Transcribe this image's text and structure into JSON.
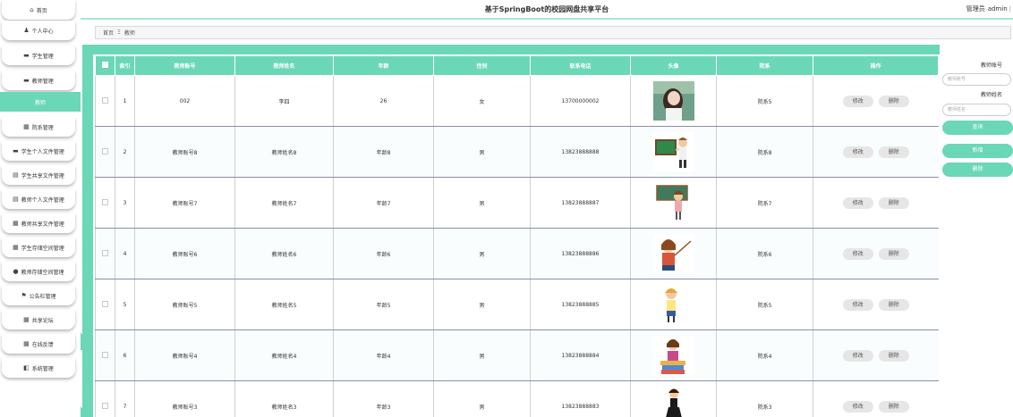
{
  "header": {
    "title": "基于SpringBoot的校园网盘共享平台",
    "role": "管理员",
    "username": "admin"
  },
  "sidebar": {
    "items": [
      {
        "icon": "home-icon",
        "glyph": "⌂",
        "label": "首页"
      },
      {
        "icon": "user-icon",
        "glyph": "♟",
        "label": "个人中心"
      },
      {
        "icon": "monitor-icon",
        "glyph": "▬",
        "label": "学生管理"
      },
      {
        "icon": "monitor-icon",
        "glyph": "▬",
        "label": "教师管理"
      },
      {
        "icon": "",
        "glyph": "",
        "label": "教师"
      },
      {
        "icon": "grid-icon",
        "glyph": "▦",
        "label": "院系管理"
      },
      {
        "icon": "monitor-icon",
        "glyph": "▬",
        "label": "学生个人文件管理"
      },
      {
        "icon": "folder-icon",
        "glyph": "▤",
        "label": "学生共享文件管理"
      },
      {
        "icon": "folder-icon",
        "glyph": "▤",
        "label": "教师个人文件管理"
      },
      {
        "icon": "grid-icon",
        "glyph": "▦",
        "label": "教师共享文件管理"
      },
      {
        "icon": "grid-icon",
        "glyph": "▦",
        "label": "学生存储空间管理"
      },
      {
        "icon": "pin-icon",
        "glyph": "●",
        "label": "教师存储空间管理"
      },
      {
        "icon": "flag-icon",
        "glyph": "⚑",
        "label": "公告栏管理"
      },
      {
        "icon": "grid-icon",
        "glyph": "▦",
        "label": "共享论坛"
      },
      {
        "icon": "grid-icon",
        "glyph": "▦",
        "label": "在线反馈"
      },
      {
        "icon": "settings-icon",
        "glyph": "◧",
        "label": "系统管理"
      }
    ]
  },
  "breadcrumb": {
    "home": "首页",
    "separator": "Ξ",
    "current": "教师"
  },
  "table": {
    "headers": [
      "索引",
      "教师账号",
      "教师姓名",
      "年龄",
      "性别",
      "联系电话",
      "头像",
      "院系",
      "操作"
    ],
    "edit_label": "修改",
    "delete_label": "删除",
    "rows": [
      {
        "index": "1",
        "account": "002",
        "name": "李四",
        "age": "26",
        "gender": "女",
        "phone": "13700000002",
        "avatar": "photo-woman",
        "dept": "院系5"
      },
      {
        "index": "2",
        "account": "教师账号8",
        "name": "教师姓名8",
        "age": "年龄8",
        "gender": "男",
        "phone": "13823888888",
        "avatar": "teacher-chalkboard",
        "dept": "院系8"
      },
      {
        "index": "3",
        "account": "教师账号7",
        "name": "教师姓名7",
        "age": "年龄7",
        "gender": "男",
        "phone": "13823888887",
        "avatar": "teacher-board",
        "dept": "院系7"
      },
      {
        "index": "4",
        "account": "教师账号6",
        "name": "教师姓名6",
        "age": "年龄6",
        "gender": "男",
        "phone": "13823888886",
        "avatar": "teacher-pointer",
        "dept": "院系6"
      },
      {
        "index": "5",
        "account": "教师账号5",
        "name": "教师姓名5",
        "age": "年龄5",
        "gender": "男",
        "phone": "13823888885",
        "avatar": "teacher-standing",
        "dept": "院系5"
      },
      {
        "index": "6",
        "account": "教师账号4",
        "name": "教师姓名4",
        "age": "年龄4",
        "gender": "男",
        "phone": "13823888884",
        "avatar": "teacher-books",
        "dept": "院系4"
      },
      {
        "index": "7",
        "account": "教师账号3",
        "name": "教师姓名3",
        "age": "年龄3",
        "gender": "男",
        "phone": "13823888883",
        "avatar": "teacher-dress",
        "dept": "院系3"
      }
    ]
  },
  "search": {
    "account_label": "教师账号",
    "account_placeholder": "教师账号",
    "name_label": "教师姓名",
    "name_placeholder": "教师姓名",
    "query_label": "查询",
    "add_label": "新增",
    "delete_label": "删除"
  },
  "colors": {
    "accent": "#6ad7b6",
    "header_border": "#a9e6d4",
    "button_gray": "#e6e6e6"
  }
}
